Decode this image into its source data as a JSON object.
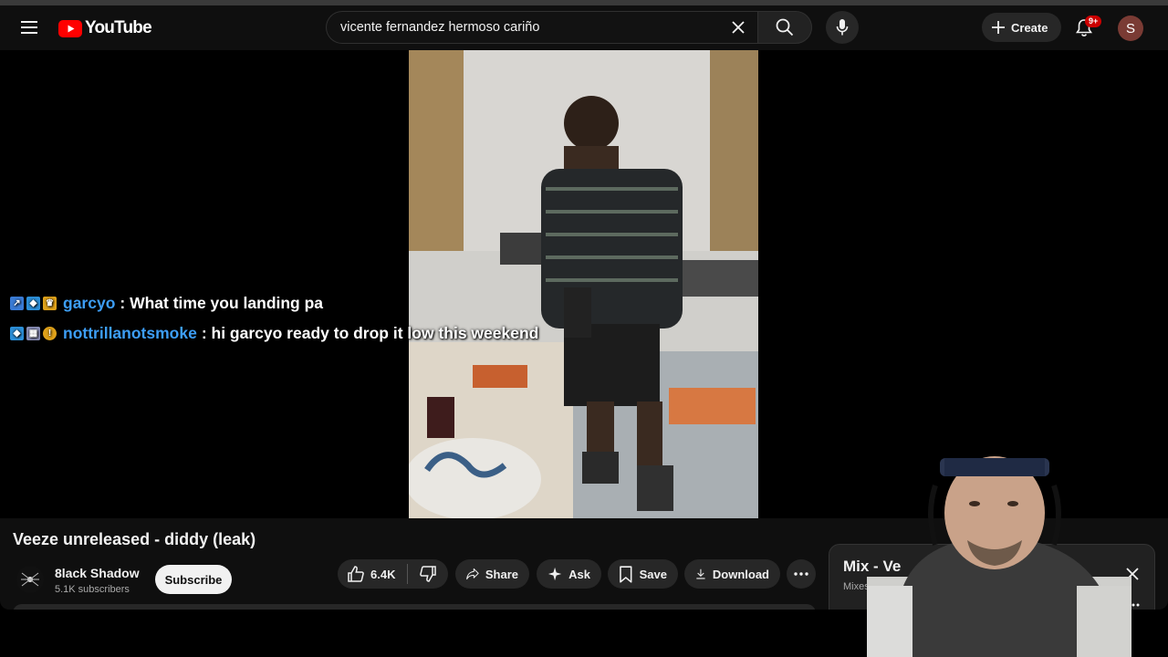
{
  "masthead": {
    "logo_text": "YouTube",
    "search": {
      "value": "vicente fernandez hermoso cariño"
    },
    "create_label": "Create",
    "notification_badge": "9+",
    "avatar_initial": "S"
  },
  "chat": [
    {
      "user": "garcyo",
      "message": ": What time you landing pa"
    },
    {
      "user": "nottrillanotsmoke",
      "message": ": hi garcyo ready to drop it low this weekend"
    }
  ],
  "video": {
    "title": "Veeze unreleased - diddy (leak)",
    "channel_name": "8lack Shadow",
    "subscribers": "5.1K subscribers",
    "subscribe_label": "Subscribe"
  },
  "actions": {
    "like_count": "6.4K",
    "share_label": "Share",
    "ask_label": "Ask",
    "save_label": "Save",
    "download_label": "Download"
  },
  "mix_panel": {
    "title": "Mix - Ve",
    "subtitle": "Mixes are pla"
  },
  "colors": {
    "brand": "#ff0000",
    "accent_link": "#3d9ef6",
    "background": "#0f0f0f"
  }
}
